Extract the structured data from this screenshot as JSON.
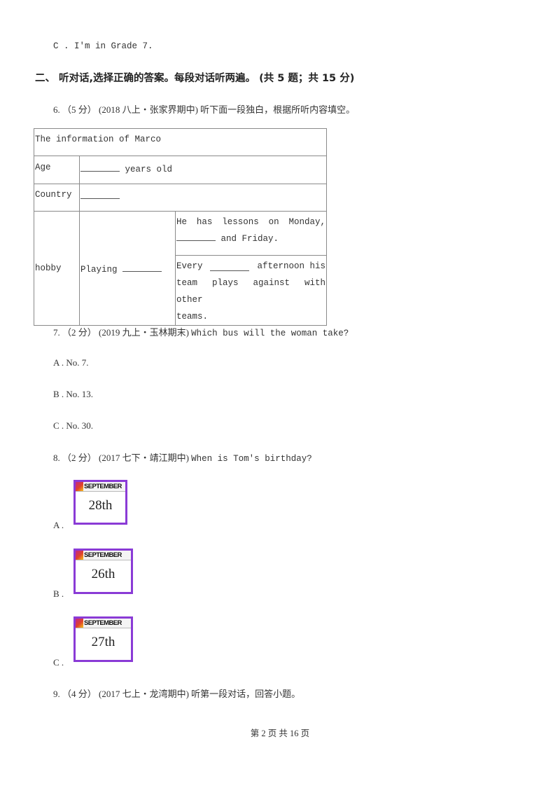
{
  "prev_option": "C . I'm in Grade 7.",
  "section": {
    "title": "二、 听对话,选择正确的答案。每段对话听两遍。 (共 5 题；共 15 分)"
  },
  "q6": {
    "prefix": "6.  （5 分） (2018 八上・张家界期中) ",
    "text": "听下面一段独白，根据所听内容填空。",
    "table": {
      "header": "The information of Marco",
      "age_label": "Age",
      "age_suffix": " years old",
      "country_label": "Country",
      "hobby_label": "hobby",
      "hobby_value": "Playing ",
      "detail1_line1": "He has lessons on Monday,",
      "detail1_line2_suffix": " and Friday.",
      "detail2_line1_prefix": "Every",
      "detail2_line1_suffix": "afternoon his",
      "detail2_line2": "team plays against with other",
      "detail2_line3": "teams."
    }
  },
  "q7": {
    "prefix": "7.  （2 分） (2019 九上・玉林期末) ",
    "text": "Which bus will the woman take?",
    "options": [
      {
        "label": "A . No. 7."
      },
      {
        "label": "B . No. 13."
      },
      {
        "label": "C . No. 30."
      }
    ]
  },
  "q8": {
    "prefix": "8.  （2 分） (2017 七下・靖江期中) ",
    "text": "When is Tom's birthday?",
    "options": [
      {
        "letter": "A .",
        "month": "SEPTEMBER",
        "day": "28th"
      },
      {
        "letter": "B .",
        "month": "SEPTEMBER",
        "day": "26th"
      },
      {
        "letter": "C .",
        "month": "SEPTEMBER",
        "day": "27th"
      }
    ]
  },
  "q9": {
    "prefix": "9.  （4 分） (2017 七上・龙湾期中) ",
    "text": "听第一段对话，回答小题。"
  },
  "footer": {
    "page": "第 2 页 共 16 页"
  },
  "colors": {
    "calendar_border": "#8a3bd6",
    "table_border": "#8a8a8a"
  }
}
